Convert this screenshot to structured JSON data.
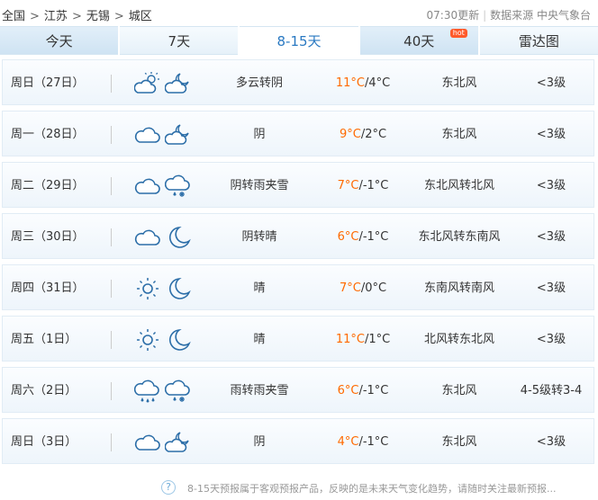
{
  "breadcrumb": {
    "items": [
      "全国",
      "江苏",
      "无锡",
      "城区"
    ],
    "sep": ">"
  },
  "update": {
    "time": "07:30更新",
    "source": "数据来源 中央气象台"
  },
  "tabs": [
    {
      "label": "今天"
    },
    {
      "label": "7天"
    },
    {
      "label": "8-15天"
    },
    {
      "label": "40天",
      "badge": "hot"
    },
    {
      "label": "雷达图"
    }
  ],
  "colors": {
    "accent": "#2a79c2",
    "high_temp": "#ff6a00",
    "hot_badge": "#ff5a2a"
  },
  "forecast": [
    {
      "day": "周日（27日）",
      "icons": [
        "cloudy-sun-icon",
        "cloudy-night-icon"
      ],
      "desc": "多云转阴",
      "high": "11°C",
      "low": "/4°C",
      "wind": "东北风",
      "level": "<3级"
    },
    {
      "day": "周一（28日）",
      "icons": [
        "cloud-icon",
        "cloudy-night-icon"
      ],
      "desc": "阴",
      "high": "9°C",
      "low": "/2°C",
      "wind": "东北风",
      "level": "<3级"
    },
    {
      "day": "周二（29日）",
      "icons": [
        "cloud-icon",
        "sleet-icon"
      ],
      "desc": "阴转雨夹雪",
      "high": "7°C",
      "low": "/-1°C",
      "wind": "东北风转北风",
      "level": "<3级"
    },
    {
      "day": "周三（30日）",
      "icons": [
        "cloud-icon",
        "moon-icon"
      ],
      "desc": "阴转晴",
      "high": "6°C",
      "low": "/-1°C",
      "wind": "东北风转东南风",
      "level": "<3级"
    },
    {
      "day": "周四（31日）",
      "icons": [
        "sun-icon",
        "moon-icon"
      ],
      "desc": "晴",
      "high": "7°C",
      "low": "/0°C",
      "wind": "东南风转南风",
      "level": "<3级"
    },
    {
      "day": "周五（1日）",
      "icons": [
        "sun-icon",
        "moon-icon"
      ],
      "desc": "晴",
      "high": "11°C",
      "low": "/1°C",
      "wind": "北风转东北风",
      "level": "<3级"
    },
    {
      "day": "周六（2日）",
      "icons": [
        "rain-icon",
        "sleet-icon"
      ],
      "desc": "雨转雨夹雪",
      "high": "6°C",
      "low": "/-1°C",
      "wind": "东北风",
      "level": "4-5级转3-4"
    },
    {
      "day": "周日（3日）",
      "icons": [
        "cloud-icon",
        "cloudy-night-icon"
      ],
      "desc": "阴",
      "high": "4°C",
      "low": "/-1°C",
      "wind": "东北风",
      "level": "<3级"
    }
  ],
  "note": {
    "icon": "question-icon",
    "text": "8-15天预报属于客观预报产品，反映的是未来天气变化趋势，请随时关注最新预报..."
  }
}
